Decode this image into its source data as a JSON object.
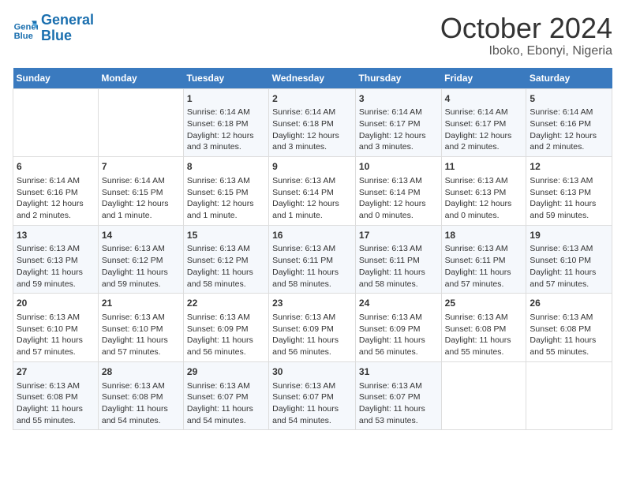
{
  "header": {
    "logo_line1": "General",
    "logo_line2": "Blue",
    "title": "October 2024",
    "subtitle": "Iboko, Ebonyi, Nigeria"
  },
  "calendar": {
    "days_of_week": [
      "Sunday",
      "Monday",
      "Tuesday",
      "Wednesday",
      "Thursday",
      "Friday",
      "Saturday"
    ],
    "weeks": [
      [
        {
          "day": "",
          "content": ""
        },
        {
          "day": "",
          "content": ""
        },
        {
          "day": "1",
          "content": "Sunrise: 6:14 AM\nSunset: 6:18 PM\nDaylight: 12 hours and 3 minutes."
        },
        {
          "day": "2",
          "content": "Sunrise: 6:14 AM\nSunset: 6:18 PM\nDaylight: 12 hours and 3 minutes."
        },
        {
          "day": "3",
          "content": "Sunrise: 6:14 AM\nSunset: 6:17 PM\nDaylight: 12 hours and 3 minutes."
        },
        {
          "day": "4",
          "content": "Sunrise: 6:14 AM\nSunset: 6:17 PM\nDaylight: 12 hours and 2 minutes."
        },
        {
          "day": "5",
          "content": "Sunrise: 6:14 AM\nSunset: 6:16 PM\nDaylight: 12 hours and 2 minutes."
        }
      ],
      [
        {
          "day": "6",
          "content": "Sunrise: 6:14 AM\nSunset: 6:16 PM\nDaylight: 12 hours and 2 minutes."
        },
        {
          "day": "7",
          "content": "Sunrise: 6:14 AM\nSunset: 6:15 PM\nDaylight: 12 hours and 1 minute."
        },
        {
          "day": "8",
          "content": "Sunrise: 6:13 AM\nSunset: 6:15 PM\nDaylight: 12 hours and 1 minute."
        },
        {
          "day": "9",
          "content": "Sunrise: 6:13 AM\nSunset: 6:14 PM\nDaylight: 12 hours and 1 minute."
        },
        {
          "day": "10",
          "content": "Sunrise: 6:13 AM\nSunset: 6:14 PM\nDaylight: 12 hours and 0 minutes."
        },
        {
          "day": "11",
          "content": "Sunrise: 6:13 AM\nSunset: 6:13 PM\nDaylight: 12 hours and 0 minutes."
        },
        {
          "day": "12",
          "content": "Sunrise: 6:13 AM\nSunset: 6:13 PM\nDaylight: 11 hours and 59 minutes."
        }
      ],
      [
        {
          "day": "13",
          "content": "Sunrise: 6:13 AM\nSunset: 6:13 PM\nDaylight: 11 hours and 59 minutes."
        },
        {
          "day": "14",
          "content": "Sunrise: 6:13 AM\nSunset: 6:12 PM\nDaylight: 11 hours and 59 minutes."
        },
        {
          "day": "15",
          "content": "Sunrise: 6:13 AM\nSunset: 6:12 PM\nDaylight: 11 hours and 58 minutes."
        },
        {
          "day": "16",
          "content": "Sunrise: 6:13 AM\nSunset: 6:11 PM\nDaylight: 11 hours and 58 minutes."
        },
        {
          "day": "17",
          "content": "Sunrise: 6:13 AM\nSunset: 6:11 PM\nDaylight: 11 hours and 58 minutes."
        },
        {
          "day": "18",
          "content": "Sunrise: 6:13 AM\nSunset: 6:11 PM\nDaylight: 11 hours and 57 minutes."
        },
        {
          "day": "19",
          "content": "Sunrise: 6:13 AM\nSunset: 6:10 PM\nDaylight: 11 hours and 57 minutes."
        }
      ],
      [
        {
          "day": "20",
          "content": "Sunrise: 6:13 AM\nSunset: 6:10 PM\nDaylight: 11 hours and 57 minutes."
        },
        {
          "day": "21",
          "content": "Sunrise: 6:13 AM\nSunset: 6:10 PM\nDaylight: 11 hours and 57 minutes."
        },
        {
          "day": "22",
          "content": "Sunrise: 6:13 AM\nSunset: 6:09 PM\nDaylight: 11 hours and 56 minutes."
        },
        {
          "day": "23",
          "content": "Sunrise: 6:13 AM\nSunset: 6:09 PM\nDaylight: 11 hours and 56 minutes."
        },
        {
          "day": "24",
          "content": "Sunrise: 6:13 AM\nSunset: 6:09 PM\nDaylight: 11 hours and 56 minutes."
        },
        {
          "day": "25",
          "content": "Sunrise: 6:13 AM\nSunset: 6:08 PM\nDaylight: 11 hours and 55 minutes."
        },
        {
          "day": "26",
          "content": "Sunrise: 6:13 AM\nSunset: 6:08 PM\nDaylight: 11 hours and 55 minutes."
        }
      ],
      [
        {
          "day": "27",
          "content": "Sunrise: 6:13 AM\nSunset: 6:08 PM\nDaylight: 11 hours and 55 minutes."
        },
        {
          "day": "28",
          "content": "Sunrise: 6:13 AM\nSunset: 6:08 PM\nDaylight: 11 hours and 54 minutes."
        },
        {
          "day": "29",
          "content": "Sunrise: 6:13 AM\nSunset: 6:07 PM\nDaylight: 11 hours and 54 minutes."
        },
        {
          "day": "30",
          "content": "Sunrise: 6:13 AM\nSunset: 6:07 PM\nDaylight: 11 hours and 54 minutes."
        },
        {
          "day": "31",
          "content": "Sunrise: 6:13 AM\nSunset: 6:07 PM\nDaylight: 11 hours and 53 minutes."
        },
        {
          "day": "",
          "content": ""
        },
        {
          "day": "",
          "content": ""
        }
      ]
    ]
  }
}
